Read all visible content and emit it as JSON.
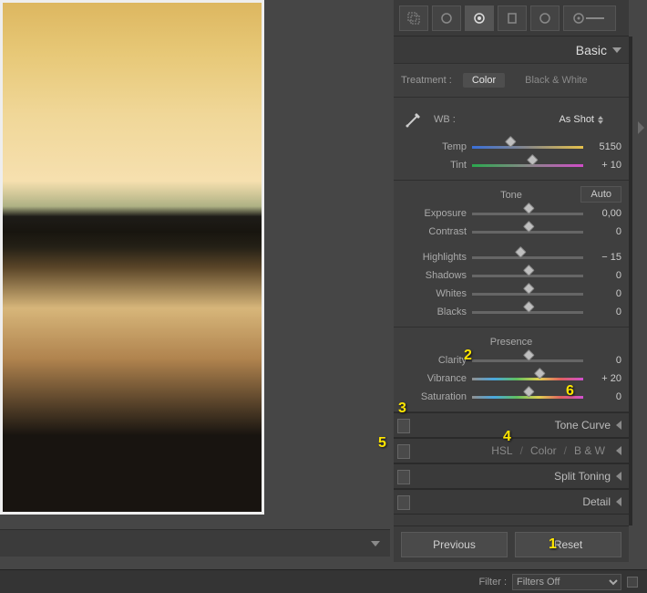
{
  "annotations": {
    "1": "1",
    "2": "2",
    "3": "3",
    "4": "4",
    "5": "5",
    "6": "6"
  },
  "panel": {
    "basic_title": "Basic",
    "treatment": {
      "label": "Treatment :",
      "color": "Color",
      "bw": "Black & White"
    },
    "wb": {
      "label": "WB :",
      "mode": "As Shot",
      "temp_label": "Temp",
      "temp_value": "5150",
      "tint_label": "Tint",
      "tint_value": "+ 10"
    },
    "tone": {
      "title": "Tone",
      "auto": "Auto",
      "exposure_label": "Exposure",
      "exposure_value": "0,00",
      "contrast_label": "Contrast",
      "contrast_value": "0",
      "highlights_label": "Highlights",
      "highlights_value": "− 15",
      "shadows_label": "Shadows",
      "shadows_value": "0",
      "whites_label": "Whites",
      "whites_value": "0",
      "blacks_label": "Blacks",
      "blacks_value": "0"
    },
    "presence": {
      "title": "Presence",
      "clarity_label": "Clarity",
      "clarity_value": "0",
      "vibrance_label": "Vibrance",
      "vibrance_value": "+ 20",
      "saturation_label": "Saturation",
      "saturation_value": "0"
    },
    "tonecurve": "Tone Curve",
    "hsl": {
      "h": "HSL",
      "c": "Color",
      "bw": "B & W"
    },
    "splittoning": "Split Toning",
    "detail": "Detail",
    "buttons": {
      "previous": "Previous",
      "reset": "Reset"
    }
  },
  "filter": {
    "label": "Filter :",
    "selected": "Filters Off"
  }
}
